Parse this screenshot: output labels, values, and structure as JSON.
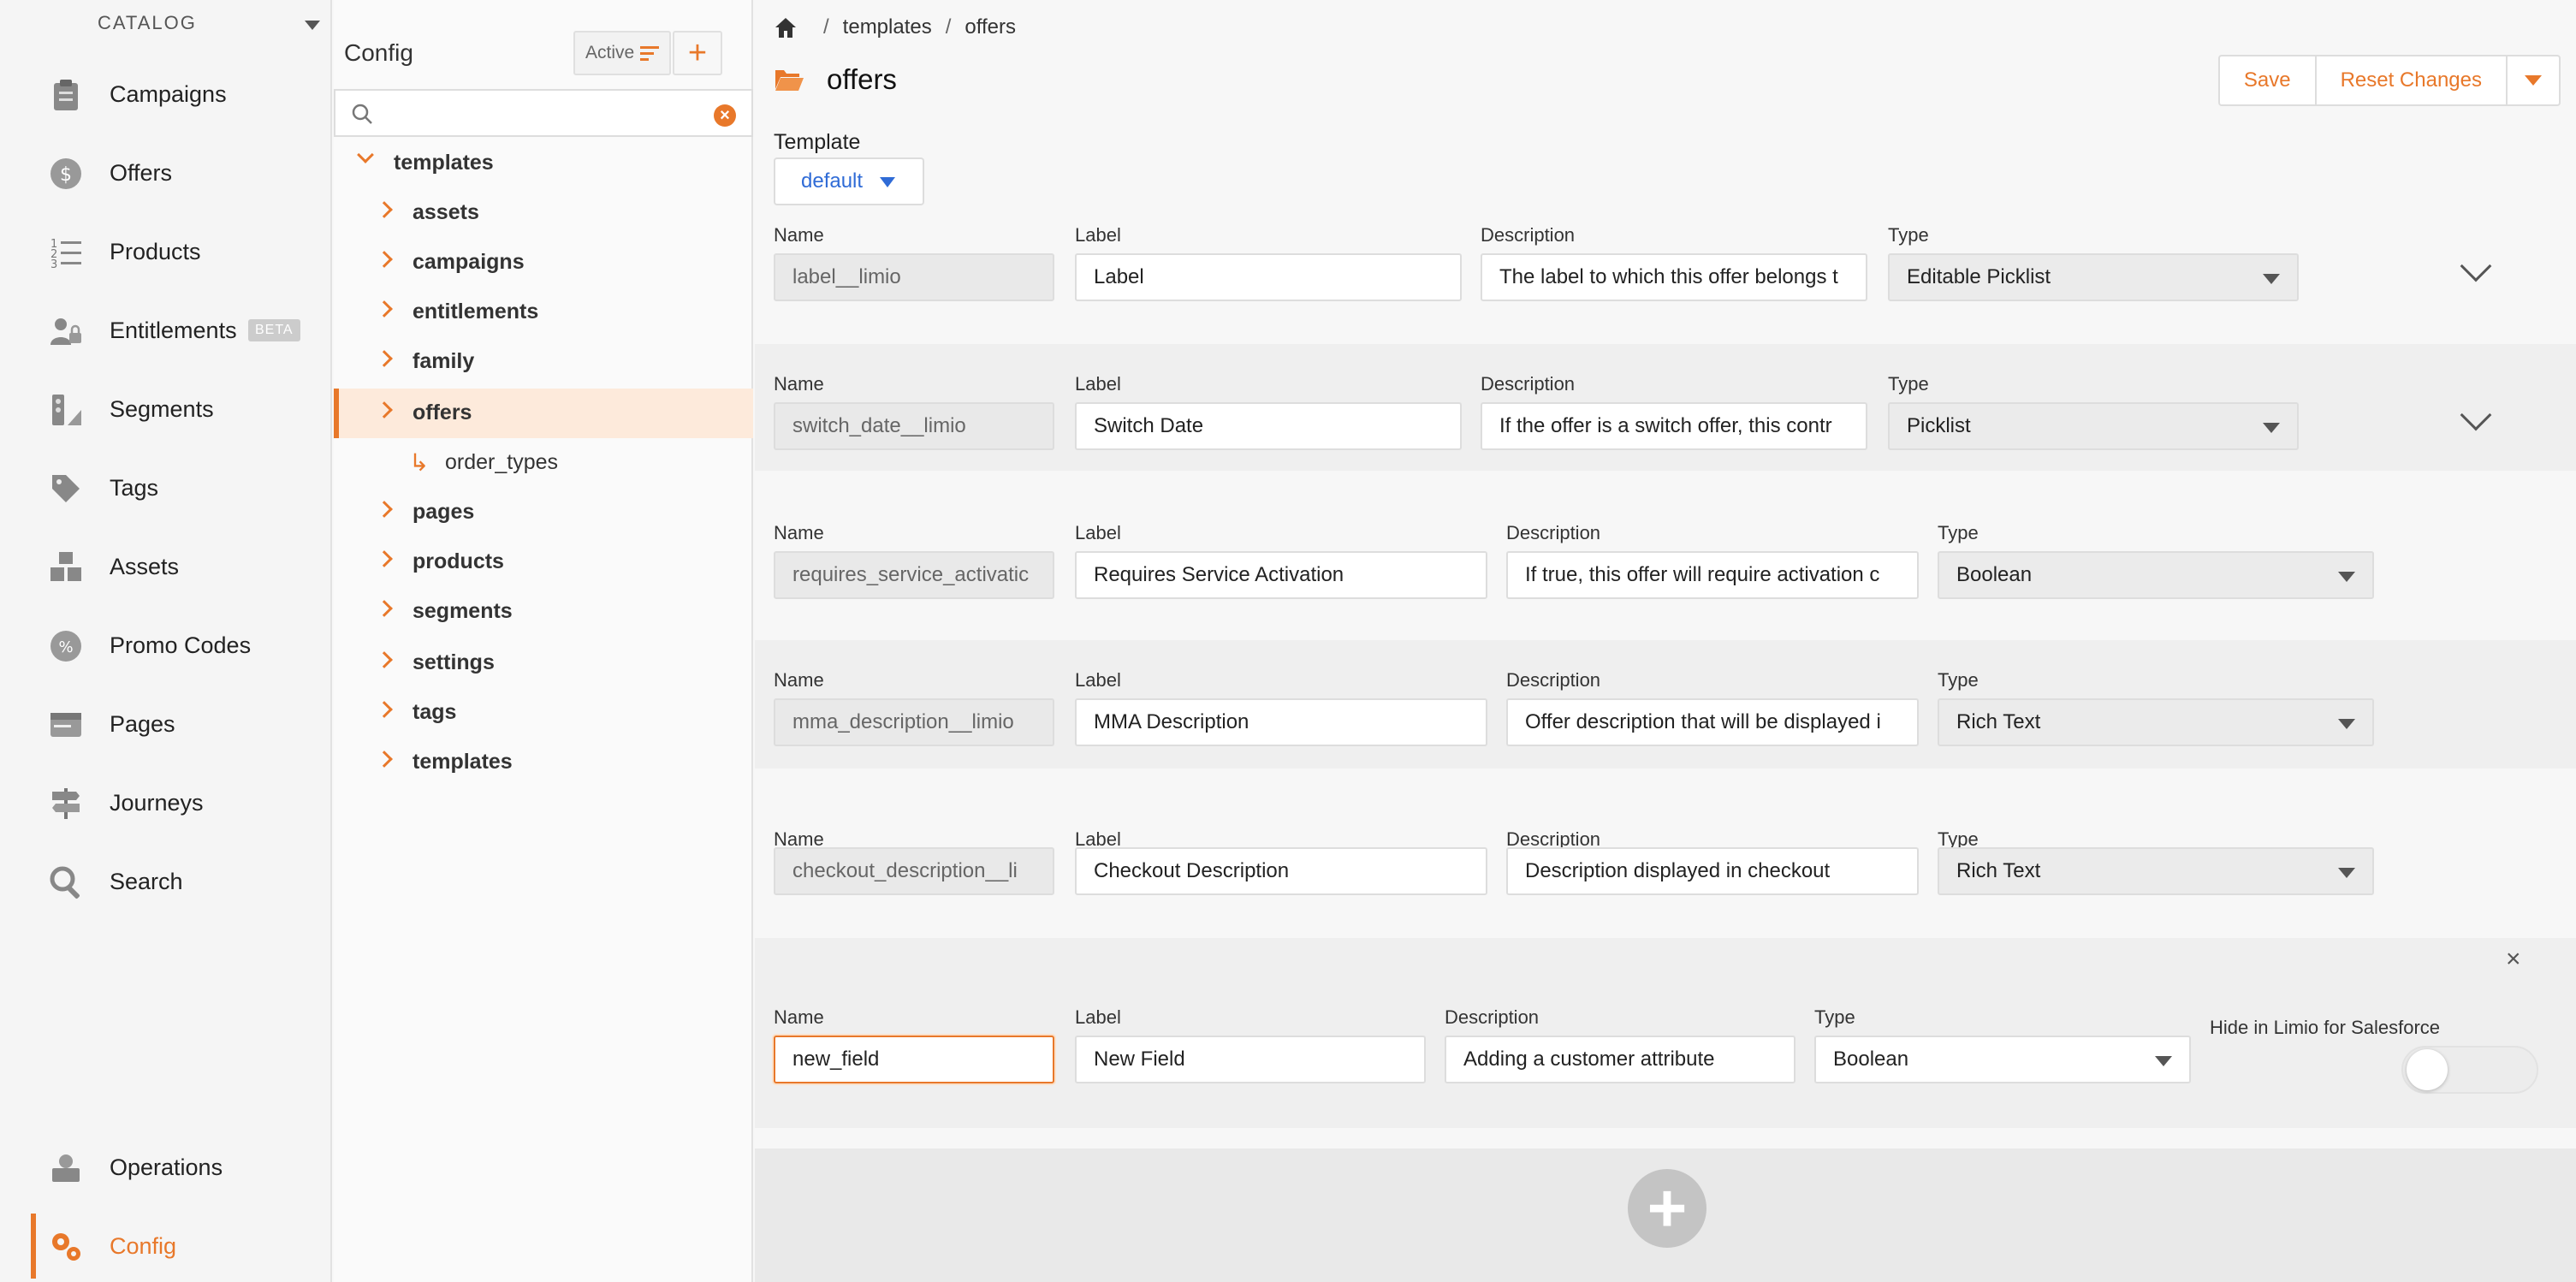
{
  "nav": {
    "section": "CATALOG",
    "items": [
      {
        "label": "Campaigns",
        "icon": "clipboard-icon"
      },
      {
        "label": "Offers",
        "icon": "dollar-badge-icon"
      },
      {
        "label": "Products",
        "icon": "numbered-list-icon"
      },
      {
        "label": "Entitlements",
        "icon": "user-lock-icon",
        "badge": "BETA"
      },
      {
        "label": "Segments",
        "icon": "segments-icon"
      },
      {
        "label": "Tags",
        "icon": "tags-icon"
      },
      {
        "label": "Assets",
        "icon": "boxes-icon"
      },
      {
        "label": "Promo Codes",
        "icon": "percent-badge-icon"
      },
      {
        "label": "Pages",
        "icon": "browser-window-icon"
      },
      {
        "label": "Journeys",
        "icon": "signpost-icon"
      },
      {
        "label": "Search",
        "icon": "magnifier-icon"
      }
    ],
    "bottom": [
      {
        "label": "Operations",
        "icon": "operations-icon"
      },
      {
        "label": "Config",
        "icon": "gears-icon",
        "active": true
      }
    ]
  },
  "tree": {
    "title": "Config",
    "filter_label": "Active",
    "root": "templates",
    "items": [
      "assets",
      "campaigns",
      "entitlements",
      "family",
      "offers",
      "order_types",
      "pages",
      "products",
      "segments",
      "settings",
      "tags",
      "templates"
    ],
    "selected": "offers"
  },
  "breadcrumb": [
    "templates",
    "offers"
  ],
  "page": {
    "title": "offers",
    "save": "Save",
    "reset": "Reset Changes"
  },
  "template": {
    "label": "Template",
    "value": "default"
  },
  "labels": {
    "name": "Name",
    "label": "Label",
    "description": "Description",
    "type": "Type",
    "hide": "Hide in Limio for Salesforce"
  },
  "fields": [
    {
      "name": "label__limio",
      "label": "Label",
      "description": "The label to which this offer belongs t",
      "type": "Editable Picklist"
    },
    {
      "name": "switch_date__limio",
      "label": "Switch Date",
      "description": "If the offer is a switch offer, this contr",
      "type": "Picklist"
    },
    {
      "name": "requires_service_activatic",
      "label": "Requires Service Activation",
      "description": "If true, this offer will require activation c",
      "type": "Boolean"
    },
    {
      "name": "mma_description__limio",
      "label": "MMA Description",
      "description": "Offer description that will be displayed i",
      "type": "Rich Text"
    },
    {
      "name": "checkout_description__li",
      "label": "Checkout Description",
      "description": "Description displayed in checkout",
      "type": "Rich Text"
    },
    {
      "name": "new_field",
      "label": "New Field",
      "description": "Adding a customer attribute",
      "type": "Boolean"
    }
  ],
  "colors": {
    "accent": "#e8782a",
    "link": "#2f6bd6"
  }
}
